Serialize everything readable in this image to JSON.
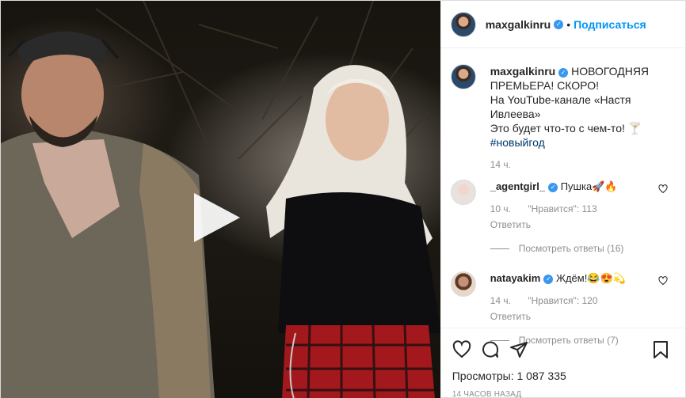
{
  "header": {
    "username": "maxgalkinru",
    "separator": "•",
    "follow_label": "Подписаться"
  },
  "caption": {
    "username": "maxgalkinru",
    "text_1": "НОВОГОДНЯЯ ПРЕМЬЕРА! СКОРО!",
    "text_2": "На YouTube-канале «Настя Ивлеева»",
    "text_3": "Это будет что-то с чем-то! 🍸",
    "hashtag": "#новыйгод",
    "time": "14 ч."
  },
  "comments": [
    {
      "username": "_agentgirl_",
      "text": "Пушка🚀🔥",
      "time": "10 ч.",
      "likes": "\"Нравится\": 113",
      "reply_label": "Ответить",
      "view_replies": "Посмотреть ответы (16)"
    },
    {
      "username": "natayakim",
      "text": "Ждём!😂😍💫",
      "time": "14 ч.",
      "likes": "\"Нравится\": 120",
      "reply_label": "Ответить",
      "view_replies": "Посмотреть ответы (7)"
    }
  ],
  "stats": {
    "views_label": "Просмотры:",
    "views_value": "1 087 335",
    "posted_ago": "14 часов назад"
  },
  "icons": {
    "play": "play-icon",
    "like": "heart-icon",
    "comment": "comment-icon",
    "share": "share-icon",
    "save": "bookmark-icon"
  },
  "colors": {
    "verified": "#3897f0",
    "follow": "#0095f6",
    "muted": "#8e8e8e"
  }
}
